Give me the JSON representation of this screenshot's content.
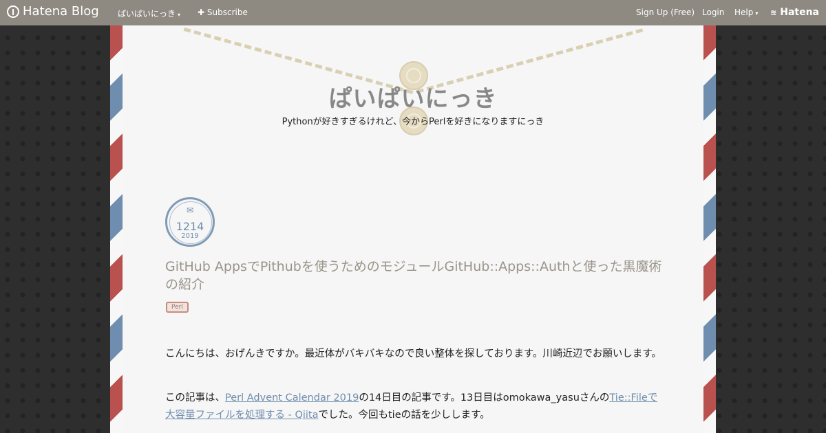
{
  "topbar": {
    "brand": "Hatena Blog",
    "blog_menu": "ぱいぱいにっき",
    "subscribe": "Subscribe",
    "signup": "Sign Up (Free)",
    "login": "Login",
    "help": "Help",
    "hatena": "Hatena"
  },
  "header": {
    "title": "ぱいぱいにっき",
    "description": "Pythonが好きすぎるけれど、今からPerlを好きになりますにっき"
  },
  "entry": {
    "date_md": "1214",
    "date_year": "2019",
    "title": "GitHub AppsでPithubを使うためのモジュールGitHub::Apps::Authと使った黒魔術の紹介",
    "category": "Perl",
    "p1": "こんにちは、おげんきですか。最近体がバキバキなので良い整体を探しております。川崎近辺でお願いします。",
    "p2_a": "この記事は、",
    "p2_link1": "Perl Advent Calendar 2019",
    "p2_b": "の14日目の記事です。13日目はomokawa_yasuさんの",
    "p2_link2": "Tie::Fileで大容量ファイルを処理する - Qiita",
    "p2_c": "でした。今回もtieの話を少しします。"
  },
  "colors": {
    "topbar": "#8e8a82",
    "stripe_red": "#b9524f",
    "stripe_blue": "#6f8dae",
    "link": "#6f8dae"
  }
}
